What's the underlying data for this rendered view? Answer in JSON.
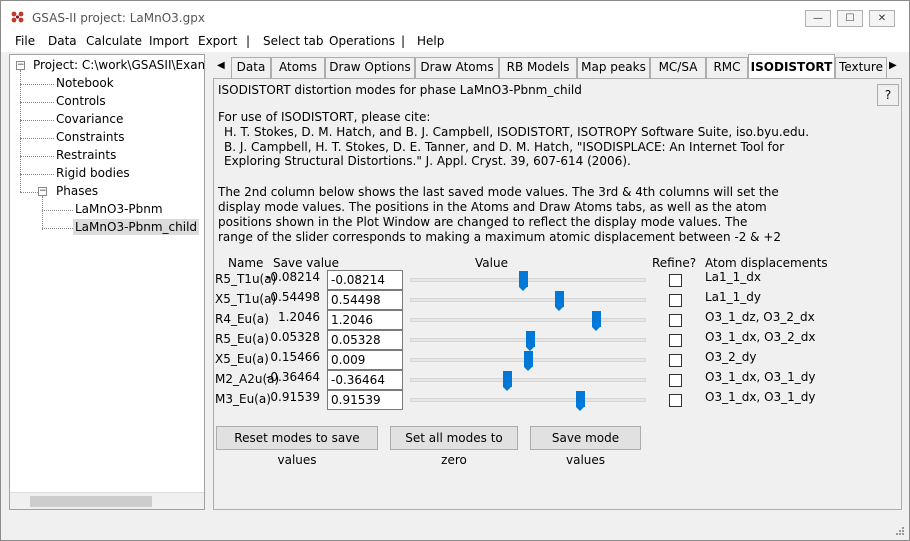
{
  "window": {
    "title": "GSAS-II project: LaMnO3.gpx",
    "minimize_label": "—",
    "maximize_label": "☐",
    "close_label": "✕"
  },
  "menubar": {
    "items": [
      "File",
      "Data",
      "Calculate",
      "Import",
      "Export",
      "|",
      "Select tab",
      "Operations",
      "|",
      "Help"
    ]
  },
  "tree": {
    "root": "Project: C:\\work\\GSASII\\Exampl",
    "items": [
      "Notebook",
      "Controls",
      "Covariance",
      "Constraints",
      "Restraints",
      "Rigid bodies"
    ],
    "phases_label": "Phases",
    "phases": [
      "LaMnO3-Pbnm",
      "LaMnO3-Pbnm_child"
    ],
    "selected": "LaMnO3-Pbnm_child"
  },
  "tabs": {
    "items": [
      "Data",
      "Atoms",
      "Draw Options",
      "Draw Atoms",
      "RB Models",
      "Map peaks",
      "MC/SA",
      "RMC",
      "ISODISTORT",
      "Texture"
    ],
    "active": "ISODISTORT"
  },
  "panel": {
    "heading": "ISODISTORT distortion modes for phase LaMnO3-Pbnm_child",
    "help_label": "?",
    "cite_intro": "For use of ISODISTORT, please cite:",
    "cite_lines": [
      "H. T. Stokes, D. M. Hatch, and B. J. Campbell, ISODISTORT, ISOTROPY Software Suite, iso.byu.edu.",
      "B. J. Campbell, H. T. Stokes, D. E. Tanner, and D. M. Hatch, \"ISODISPLACE: An Internet Tool for",
      "Exploring Structural Distortions.\" J. Appl. Cryst. 39, 607-614 (2006)."
    ],
    "info_lines": [
      "The 2nd column below shows the last saved mode values. The 3rd & 4th columns will set the",
      "display mode values. The positions in the Atoms and Draw Atoms tabs, as well as the atom",
      "positions shown in the Plot Window are changed to reflect the display mode values. The",
      "range of the slider corresponds to making a maximum atomic displacement between -2 & +2"
    ],
    "columns": {
      "name": "Name",
      "save": "Save value",
      "value": "Value",
      "refine": "Refine?",
      "atoms": "Atom displacements"
    },
    "modes": [
      {
        "name": "R5_T1u(a)",
        "save": "-0.08214",
        "value": "-0.08214",
        "slider_fraction": 0.48,
        "refine": false,
        "atoms": "La1_1_dx"
      },
      {
        "name": "X5_T1u(a)",
        "save": "0.54498",
        "value": "0.54498",
        "slider_fraction": 0.63,
        "refine": false,
        "atoms": "La1_1_dy"
      },
      {
        "name": "R4_Eu(a)",
        "save": "1.2046",
        "value": "1.2046",
        "slider_fraction": 0.79,
        "refine": false,
        "atoms": "O3_1_dz, O3_2_dx"
      },
      {
        "name": "R5_Eu(a)",
        "save": "0.05328",
        "value": "0.05328",
        "slider_fraction": 0.51,
        "refine": false,
        "atoms": "O3_1_dx, O3_2_dx"
      },
      {
        "name": "X5_Eu(a)",
        "save": "0.15466",
        "value": "0.009",
        "slider_fraction": 0.5,
        "refine": false,
        "atoms": "O3_2_dy"
      },
      {
        "name": "M2_A2u(a)",
        "save": "-0.36464",
        "value": "-0.36464",
        "slider_fraction": 0.41,
        "refine": false,
        "atoms": "O3_1_dx, O3_1_dy"
      },
      {
        "name": "M3_Eu(a)",
        "save": "0.91539",
        "value": "0.91539",
        "slider_fraction": 0.72,
        "refine": false,
        "atoms": "O3_1_dx, O3_1_dy"
      }
    ],
    "buttons": {
      "reset": "Reset modes to save values",
      "zero": "Set all modes to zero",
      "save": "Save mode values"
    }
  },
  "colors": {
    "slider_thumb": "#0078d7",
    "tree_selection": "#dcdcdc"
  }
}
